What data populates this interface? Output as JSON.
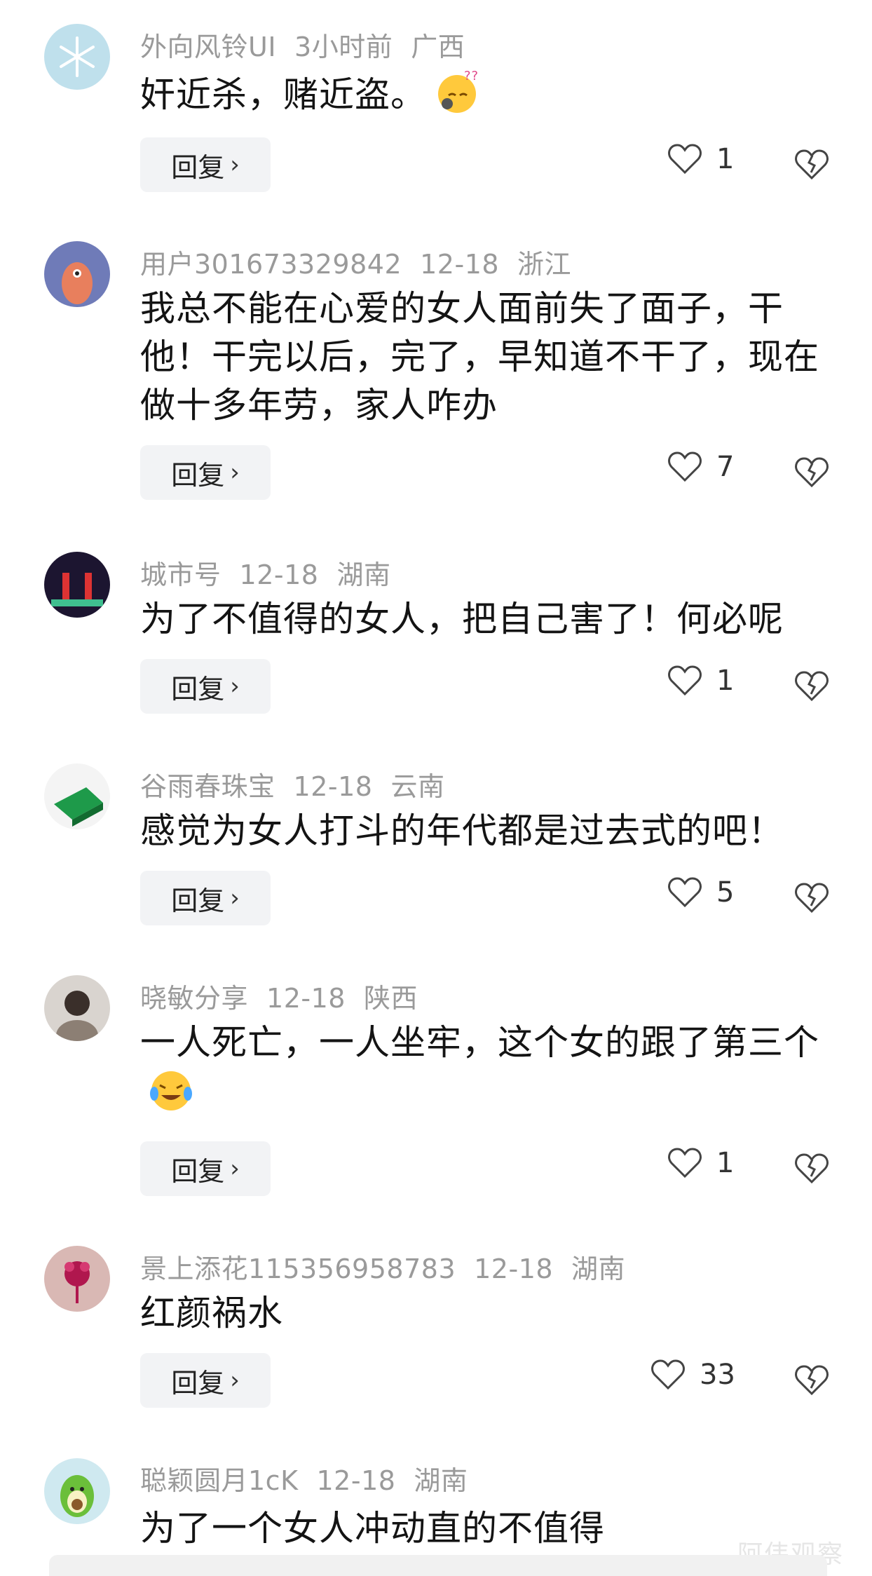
{
  "reply_label": "回复",
  "comments": [
    {
      "user": "外向风铃UI",
      "time": "3小时前",
      "location": "广西",
      "text": "奸近杀，赌近盗。",
      "likes": "1",
      "emoji": "thinking-sleepy-emoji"
    },
    {
      "user": "用户301673329842",
      "time": "12-18",
      "location": "浙江",
      "text": "我总不能在心爱的女人面前失了面子，干他！干完以后，完了，早知道不干了，现在做十多年劳，家人咋办",
      "likes": "7"
    },
    {
      "user": "城市号",
      "time": "12-18",
      "location": "湖南",
      "text": "为了不值得的女人，把自己害了！何必呢",
      "likes": "1"
    },
    {
      "user": "谷雨春珠宝",
      "time": "12-18",
      "location": "云南",
      "text": "感觉为女人打斗的年代都是过去式的吧！",
      "likes": "5"
    },
    {
      "user": "晓敏分享",
      "time": "12-18",
      "location": "陕西",
      "text": "一人死亡，一人坐牢，这个女的跟了第三个",
      "likes": "1",
      "emoji": "crying-laughing-emoji"
    },
    {
      "user": "景上添花115356958783",
      "time": "12-18",
      "location": "湖南",
      "text": "红颜祸水",
      "likes": "33"
    },
    {
      "user": "聪颖圆月1cK",
      "time": "12-18",
      "location": "湖南",
      "text": "为了一个女人冲动直的不值得"
    }
  ],
  "watermark": "阿伟观察"
}
